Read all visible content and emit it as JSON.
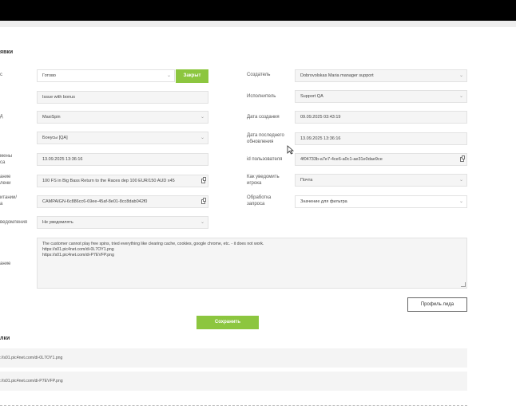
{
  "sections": {
    "request_title": "явки",
    "links_title": "лки"
  },
  "left": {
    "status": {
      "label": "с",
      "value": "Готово",
      "close_button": "Закрыт"
    },
    "subject": {
      "label": "",
      "value": "Issue with bonus"
    },
    "project": {
      "label": "д",
      "value": "MaxiSpin"
    },
    "category": {
      "label": "",
      "value": "Бонусы [QA]"
    },
    "change_time": {
      "label_line1": "мены",
      "label_line2": "са",
      "value": "13.09.2025 13:36:16"
    },
    "bonus": {
      "label_line1": "ание",
      "label_line2": "лени",
      "value": "100 FS in Big Bass Return to the Races dep 100 EUR/150 AUD x45"
    },
    "campaign": {
      "label_line1": "итании/",
      "label_line2": "а",
      "value": "CAMPAIGN-6c886cc6-69ee-45af-8e01-8cc8dab042f0"
    },
    "notify": {
      "label": "ведомления",
      "value": "Не уведомлять"
    },
    "description": {
      "label": "ание",
      "lines": [
        "The customer cannot play free spins, tried everything like clearing cache, cookies, google chrome, etc. - it does not work.",
        "https://s01.pic4net.com/di-0L7OY1.png",
        "https://s01.pic4net.com/di-P7EVFP.png"
      ]
    }
  },
  "right": {
    "creator": {
      "label": "Создатель",
      "value": "Dobrovolskas Maria manager support"
    },
    "assignee": {
      "label": "Исполнитель",
      "value": "Support QA"
    },
    "created": {
      "label": "Дата создания",
      "value": "09.09.2025 03:43:19"
    },
    "updated": {
      "label_line1": "Дата последнего",
      "label_line2": "обновления",
      "value": "13.09.2025 13:36:16"
    },
    "user_id": {
      "label": "id пользователя",
      "value": "4f04733b-a7e7-4ce6-a0c1-ae31e0dae9ce"
    },
    "how_notify": {
      "label_line1": "Как уведомить",
      "label_line2": "игрока",
      "value": "Почта"
    },
    "processing": {
      "label_line1": "Обработка",
      "label_line2": "запроса",
      "value": "Значение для фильтра"
    }
  },
  "buttons": {
    "lead_profile": "Профиль лида",
    "save": "Сохранить"
  },
  "links": [
    "://s01.pic4net.com/di-0L7OY1.png",
    "://s01.pic4net.com/di-P7EVFP.png"
  ],
  "colors": {
    "accent_green": "#8cc63f"
  }
}
